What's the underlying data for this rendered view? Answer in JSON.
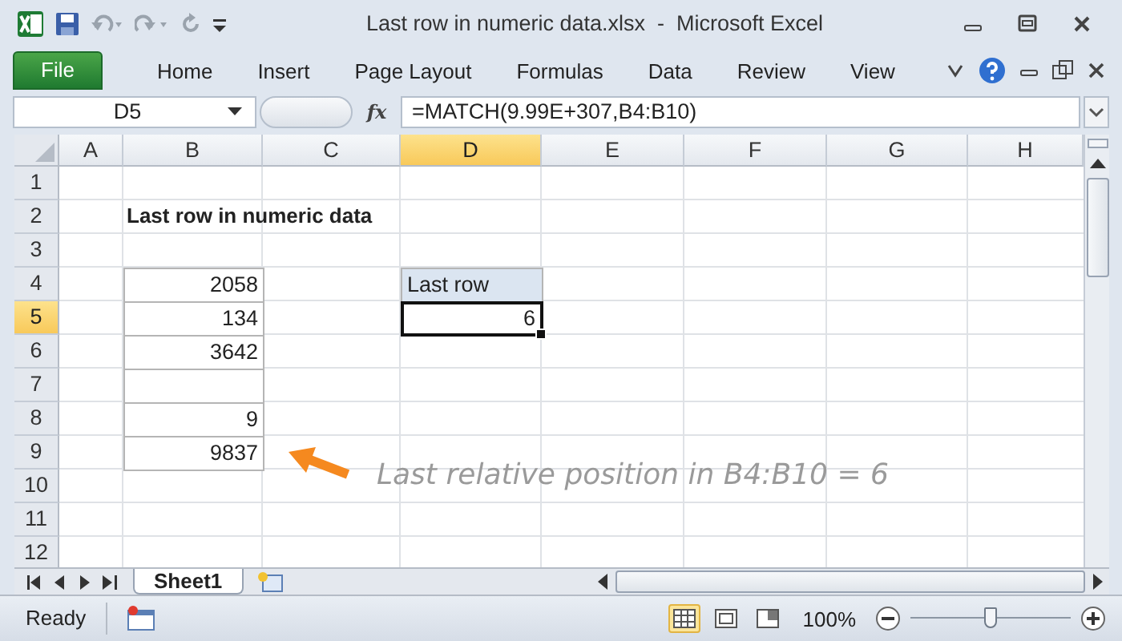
{
  "window": {
    "title": "Last row in numeric data.xlsx  -  Microsoft Excel"
  },
  "file_button": "File",
  "ribbon_tabs": [
    "Home",
    "Insert",
    "Page Layout",
    "Formulas",
    "Data",
    "Review",
    "View"
  ],
  "formula_bar": {
    "name_box": "D5",
    "fx": "fx",
    "formula": "=MATCH(9.99E+307,B4:B10)"
  },
  "columns": [
    {
      "label": "A",
      "selected": false
    },
    {
      "label": "B",
      "selected": false
    },
    {
      "label": "C",
      "selected": false
    },
    {
      "label": "D",
      "selected": true
    },
    {
      "label": "E",
      "selected": false
    },
    {
      "label": "F",
      "selected": false
    },
    {
      "label": "G",
      "selected": false
    },
    {
      "label": "H",
      "selected": false
    }
  ],
  "rows": [
    {
      "label": "1",
      "selected": false
    },
    {
      "label": "2",
      "selected": false
    },
    {
      "label": "3",
      "selected": false
    },
    {
      "label": "4",
      "selected": false
    },
    {
      "label": "5",
      "selected": true
    },
    {
      "label": "6",
      "selected": false
    },
    {
      "label": "7",
      "selected": false
    },
    {
      "label": "8",
      "selected": false
    },
    {
      "label": "9",
      "selected": false
    },
    {
      "label": "10",
      "selected": false
    },
    {
      "label": "11",
      "selected": false
    },
    {
      "label": "12",
      "selected": false
    }
  ],
  "sheet_title": "Last row in numeric data",
  "numbers": [
    {
      "kind": "number",
      "value": "2058"
    },
    {
      "kind": "number",
      "value": "134"
    },
    {
      "kind": "number",
      "value": "3642"
    },
    {
      "kind": "empty"
    },
    {
      "kind": "number",
      "value": "9"
    },
    {
      "kind": "number",
      "value": "9837"
    }
  ],
  "result": {
    "label": "Last row",
    "value": "6",
    "selected": true
  },
  "annotation": "Last relative position in B4:B10 = 6",
  "sheet_tabs": [
    {
      "label": "Sheet1",
      "selected": true
    }
  ],
  "status_bar": {
    "mode": "Ready",
    "views": [
      {
        "kind": "normal",
        "selected": true
      },
      {
        "kind": "page_layout",
        "selected": false
      },
      {
        "kind": "page_break",
        "selected": false
      }
    ],
    "zoom": "100%",
    "zoom_level": {
      "level": 0.5
    }
  }
}
